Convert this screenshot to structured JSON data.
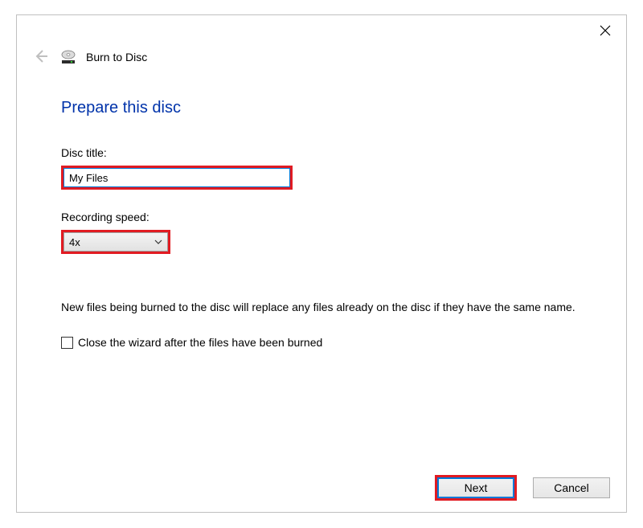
{
  "window": {
    "title": "Burn to Disc"
  },
  "heading": "Prepare this disc",
  "fields": {
    "discTitleLabel": "Disc title:",
    "discTitleValue": "My Files",
    "recordingSpeedLabel": "Recording speed:",
    "recordingSpeedValue": "4x"
  },
  "info": "New files being burned to the disc will replace any files already on the disc if they have the same name.",
  "checkboxLabel": "Close the wizard after the files have been burned",
  "buttons": {
    "next": "Next",
    "cancel": "Cancel"
  }
}
